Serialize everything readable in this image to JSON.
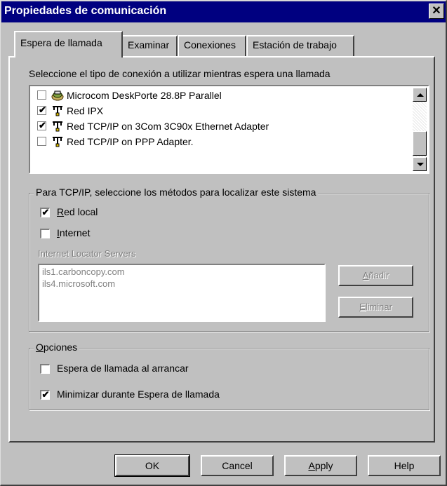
{
  "window": {
    "title": "Propiedades de comunicación",
    "close_glyph": "✕"
  },
  "tabs": [
    {
      "label": "Espera de llamada",
      "active": true
    },
    {
      "label": "Examinar",
      "active": false
    },
    {
      "label": "Conexiones",
      "active": false
    },
    {
      "label": "Estación de trabajo",
      "active": false
    }
  ],
  "connection_section": {
    "instruction": "Seleccione el tipo de conexión a utilizar mientras espera una llamada",
    "items": [
      {
        "label": "Microcom DeskPorte 28.8P Parallel",
        "checked": false,
        "icon": "modem-icon"
      },
      {
        "label": "Red IPX",
        "checked": true,
        "icon": "network-icon"
      },
      {
        "label": "Red TCP/IP on 3Com 3C90x Ethernet Adapter",
        "checked": true,
        "icon": "network-icon"
      },
      {
        "label": "Red TCP/IP on PPP Adapter.",
        "checked": false,
        "icon": "network-icon"
      }
    ]
  },
  "tcpip_group": {
    "legend": "Para TCP/IP, seleccione los métodos para localizar este sistema",
    "red_local": {
      "label_hot": "R",
      "label_rest": "ed local",
      "checked": true
    },
    "internet": {
      "label_hot": "I",
      "label_rest": "nternet",
      "checked": false
    },
    "servers_label": "Internet Locator Servers",
    "servers": [
      "ils1.carboncopy.com",
      "ils4.microsoft.com"
    ],
    "add_button": {
      "hot": "A",
      "rest": "ñadir"
    },
    "remove_button": {
      "hot": "E",
      "rest": "liminar"
    }
  },
  "options_group": {
    "legend_hot": "O",
    "legend_rest": "pciones",
    "start_on_boot": {
      "label": "Espera de llamada al arrancar",
      "checked": false
    },
    "minimize": {
      "label": "Minimizar durante Espera de llamada",
      "checked": true
    }
  },
  "buttons": {
    "ok": "OK",
    "cancel": "Cancel",
    "apply_hot": "A",
    "apply_rest": "pply",
    "help": "Help"
  },
  "check_glyph": "✔",
  "colors": {
    "titlebar": "#000080",
    "face": "#c0c0c0",
    "disabled_text": "#808080"
  }
}
